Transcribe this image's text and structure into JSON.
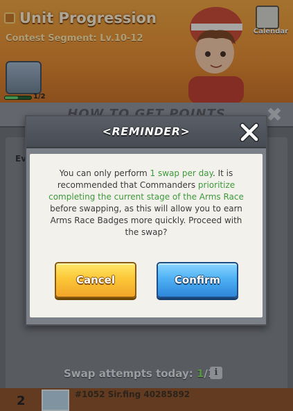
{
  "background": {
    "title": "Unit Progression",
    "subtitle": "Contest Segment: Lv.10-12",
    "calendar_label": "Calendar",
    "chest_progress_label": "1/2",
    "chest_progress_fraction": 0.5,
    "panel_title": "HOW TO GET POINTS",
    "row_label": "Ev",
    "side_text": "t",
    "swap_label": "Swap attempts today: ",
    "swap_used": "1",
    "swap_total": "/1",
    "bottom_rank": "2",
    "bottom_text": "#1052 Sir.fing 40285892"
  },
  "dialog": {
    "title": "<REMINDER>",
    "message": {
      "p1": "You can only perform ",
      "h1": "1 swap per day",
      "p2": ". It is recommended that Commanders ",
      "h2": "prioritize completing the current stage of the Arms Race",
      "p3": " before swapping, as this will allow you to earn Arms Race Badges more quickly. Proceed with the swap?"
    },
    "cancel_label": "Cancel",
    "confirm_label": "Confirm"
  },
  "colors": {
    "highlight_green": "#3e9a3a",
    "cancel_yellow": "#fcc737",
    "confirm_blue": "#4fb2f4",
    "dialog_gray": "#7b8088"
  },
  "icons": [
    "back-icon",
    "calendar-icon",
    "close-icon",
    "info-icon"
  ]
}
